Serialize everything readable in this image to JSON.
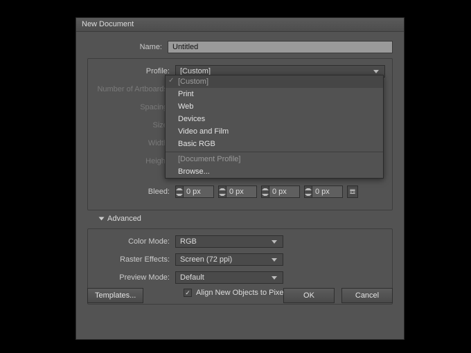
{
  "dialog": {
    "title": "New Document"
  },
  "fields": {
    "name_label": "Name:",
    "name_value": "Untitled",
    "profile_label": "Profile:",
    "profile_value": "[Custom]",
    "artboards_label": "Number of Artboards:",
    "spacing_label": "Spacing:",
    "size_label": "Size:",
    "width_label": "Width:",
    "height_label": "Height:",
    "bleed_label": "Bleed:"
  },
  "dropdown": {
    "items": [
      "[Custom]",
      "Print",
      "Web",
      "Devices",
      "Video and Film",
      "Basic RGB",
      "[Document Profile]",
      "Browse..."
    ]
  },
  "bleed": {
    "top": "0 px",
    "bottom": "0 px",
    "left": "0 px",
    "right": "0 px"
  },
  "advanced": {
    "heading": "Advanced",
    "color_mode_label": "Color Mode:",
    "color_mode_value": "RGB",
    "raster_label": "Raster Effects:",
    "raster_value": "Screen (72 ppi)",
    "preview_label": "Preview Mode:",
    "preview_value": "Default",
    "align_label": "Align New Objects to Pixel Grid"
  },
  "buttons": {
    "templates": "Templates...",
    "ok": "OK",
    "cancel": "Cancel"
  }
}
